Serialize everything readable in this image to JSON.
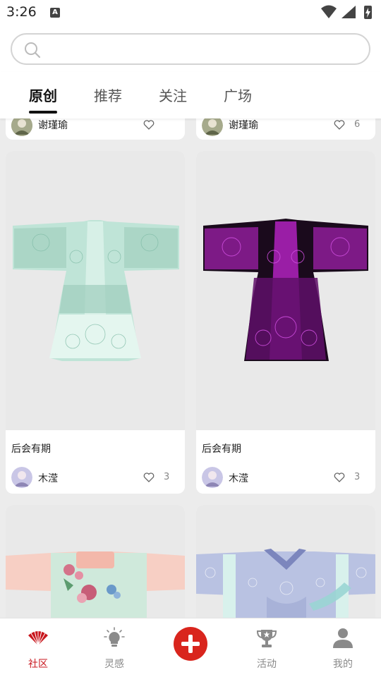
{
  "status_bar": {
    "time": "3:26",
    "a_icon": "A"
  },
  "search": {
    "placeholder": ""
  },
  "tabs": [
    {
      "label": "原创",
      "active": true
    },
    {
      "label": "推荐",
      "active": false
    },
    {
      "label": "关注",
      "active": false
    },
    {
      "label": "广场",
      "active": false
    }
  ],
  "feed": {
    "top_row": [
      {
        "author": "谢瑾瑜",
        "likes": ""
      },
      {
        "author": "谢瑾瑜",
        "likes": "6"
      }
    ],
    "cards": [
      {
        "title": "后会有期",
        "author": "木滢",
        "likes": "3",
        "garment_color": "mint"
      },
      {
        "title": "后会有期",
        "author": "木滢",
        "likes": "3",
        "garment_color": "purple"
      }
    ],
    "bottom_row": [
      {
        "garment_color": "peach-mint"
      },
      {
        "garment_color": "lavender"
      }
    ]
  },
  "bottom_nav": [
    {
      "label": "社区",
      "icon": "fan-icon",
      "active": true
    },
    {
      "label": "灵感",
      "icon": "lightbulb-icon",
      "active": false
    },
    {
      "label": "",
      "icon": "plus-icon",
      "active": false
    },
    {
      "label": "活动",
      "icon": "trophy-icon",
      "active": false
    },
    {
      "label": "我的",
      "icon": "person-icon",
      "active": false
    }
  ],
  "colors": {
    "accent": "#d9251d",
    "active_label": "#c8161d"
  }
}
